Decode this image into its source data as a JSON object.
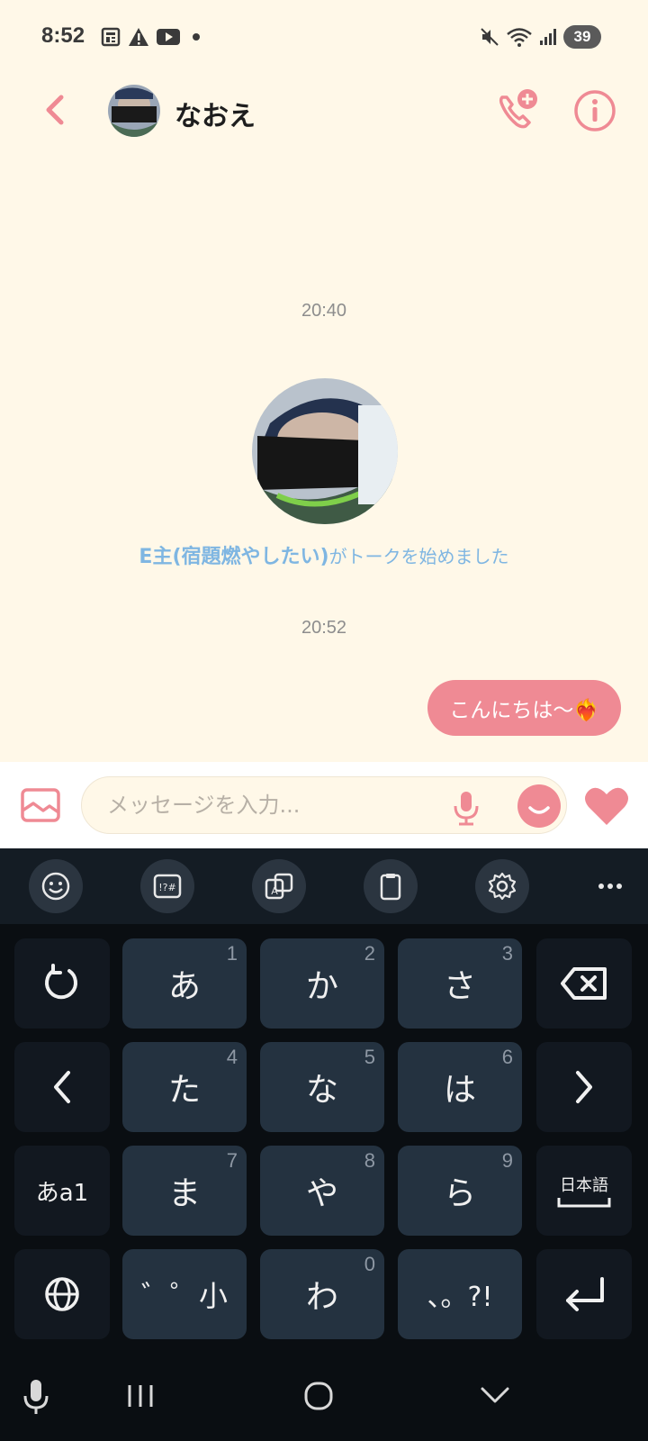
{
  "status_bar": {
    "time": "8:52",
    "battery": "39",
    "icons": [
      "news-icon",
      "warning-icon",
      "youtube-icon",
      "dot-icon",
      "mute-icon",
      "wifi-icon",
      "signal-icon"
    ]
  },
  "header": {
    "contact_name": "なおえ",
    "icons": [
      "back-icon",
      "add-call-icon",
      "info-icon"
    ]
  },
  "chat": {
    "timestamp_1": "20:40",
    "join_name": "E主(宿題燃やしたい)",
    "join_text": "がトークを始めました",
    "timestamp_2": "20:52",
    "sent_message": "こんにちは〜❤️‍🔥"
  },
  "input_bar": {
    "placeholder": "メッセージを入力...",
    "value": ""
  },
  "keyboard": {
    "toolbar": [
      "emoji-icon",
      "symbols-icon",
      "translate-icon",
      "clipboard-icon",
      "settings-icon",
      "more-icon"
    ],
    "rows": [
      [
        {
          "label": "↻",
          "num": ""
        },
        {
          "label": "あ",
          "num": "1"
        },
        {
          "label": "か",
          "num": "2"
        },
        {
          "label": "さ",
          "num": "3"
        },
        {
          "label": "⌫",
          "num": ""
        }
      ],
      [
        {
          "label": "<",
          "num": ""
        },
        {
          "label": "た",
          "num": "4"
        },
        {
          "label": "な",
          "num": "5"
        },
        {
          "label": "は",
          "num": "6"
        },
        {
          "label": ">",
          "num": ""
        }
      ],
      [
        {
          "label": "あa1",
          "num": ""
        },
        {
          "label": "ま",
          "num": "7"
        },
        {
          "label": "や",
          "num": "8"
        },
        {
          "label": "ら",
          "num": "9"
        },
        {
          "label": "日本語",
          "num": ""
        }
      ],
      [
        {
          "label": "🌐",
          "num": ""
        },
        {
          "label": "゛゜小",
          "num": ""
        },
        {
          "label": "わ",
          "num": "0"
        },
        {
          "label": "、。?!",
          "num": ""
        },
        {
          "label": "⏎",
          "num": ""
        }
      ]
    ]
  },
  "nav_bar": {
    "icons": [
      "voice-input-icon",
      "recents-icon",
      "home-icon",
      "hide-keyboard-icon"
    ]
  },
  "colors": {
    "accent": "#ef8a94",
    "background": "#fff8e8",
    "link_blue": "#7fb6e2",
    "keyboard_bg": "#0a0e12",
    "key_bg": "#243240"
  }
}
